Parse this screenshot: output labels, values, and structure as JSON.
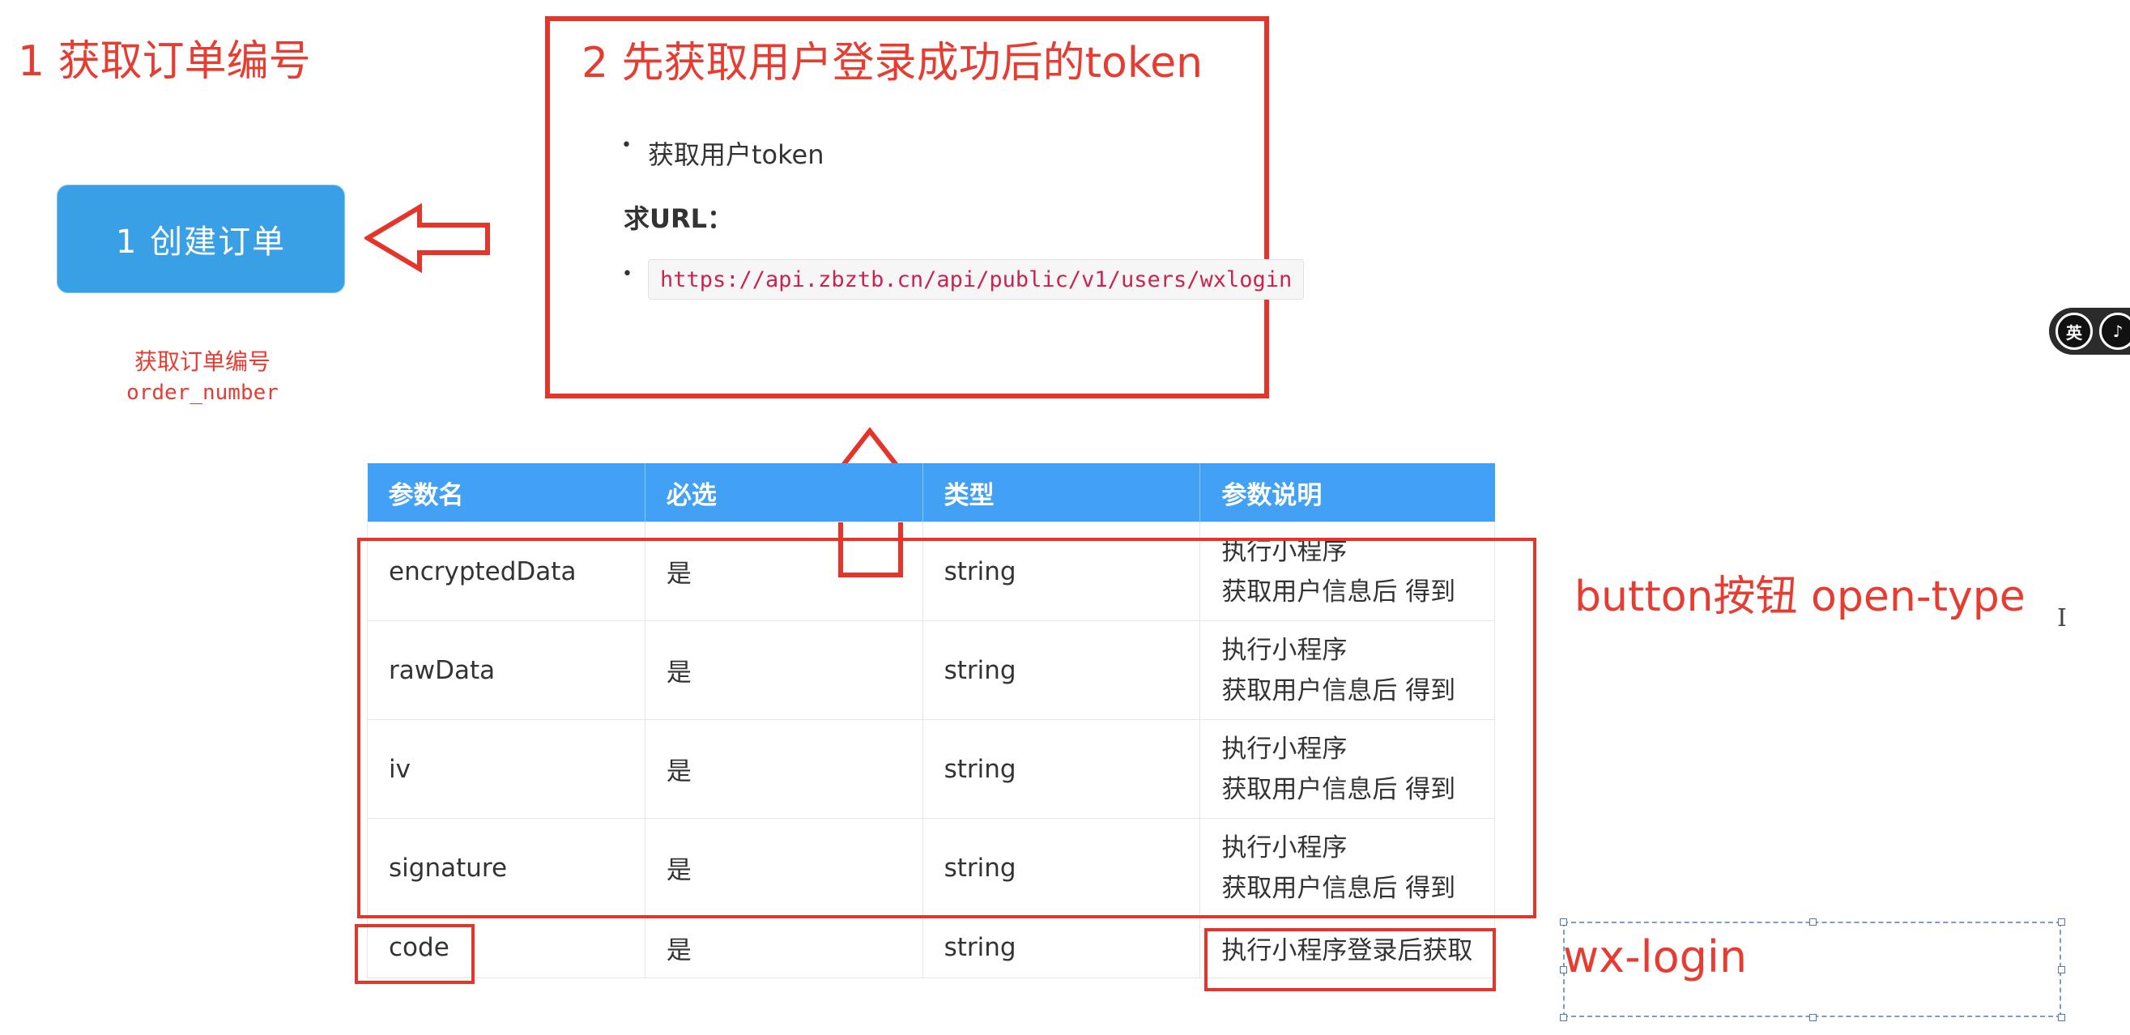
{
  "annotations": {
    "step1_title": "1 获取订单编号",
    "step2_title": "2 先获取用户登录成功后的token",
    "order_note_line1": "获取订单编号",
    "order_note_line2": "order_number",
    "open_type_label": "button按钮 open-type",
    "wx_login_label": "wx-login"
  },
  "create_order_button": {
    "label": "1  创建订单"
  },
  "token_section": {
    "bullet": "获取用户token",
    "url_label": "求URL：",
    "url": "https://api.zbztb.cn/api/public/v1/users/wxlogin"
  },
  "param_table": {
    "headers": [
      "参数名",
      "必选",
      "类型",
      "参数说明"
    ],
    "rows": [
      {
        "name": "encryptedData",
        "required": "是",
        "type": "string",
        "desc_line1": "执行小程序",
        "desc_line2": "获取用户信息后 得到"
      },
      {
        "name": "rawData",
        "required": "是",
        "type": "string",
        "desc_line1": "执行小程序",
        "desc_line2": "获取用户信息后 得到"
      },
      {
        "name": "iv",
        "required": "是",
        "type": "string",
        "desc_line1": "执行小程序",
        "desc_line2": "获取用户信息后 得到"
      },
      {
        "name": "signature",
        "required": "是",
        "type": "string",
        "desc_line1": "执行小程序",
        "desc_line2": "获取用户信息后 得到"
      },
      {
        "name": "code",
        "required": "是",
        "type": "string",
        "desc_line1": "执行小程序登录后获取",
        "desc_line2": ""
      }
    ]
  },
  "ime": {
    "lang_label": "英",
    "second_label": "♪"
  },
  "icons": {
    "left_arrow": "outline-left-arrow-icon",
    "up_arrow": "outline-up-arrow-icon",
    "cursor": "text-cursor-icon"
  },
  "colors": {
    "annotation_red": "#e63c32",
    "button_blue": "#3aa0e5",
    "table_header_blue": "#42a1f5",
    "code_red": "#c7254e"
  }
}
